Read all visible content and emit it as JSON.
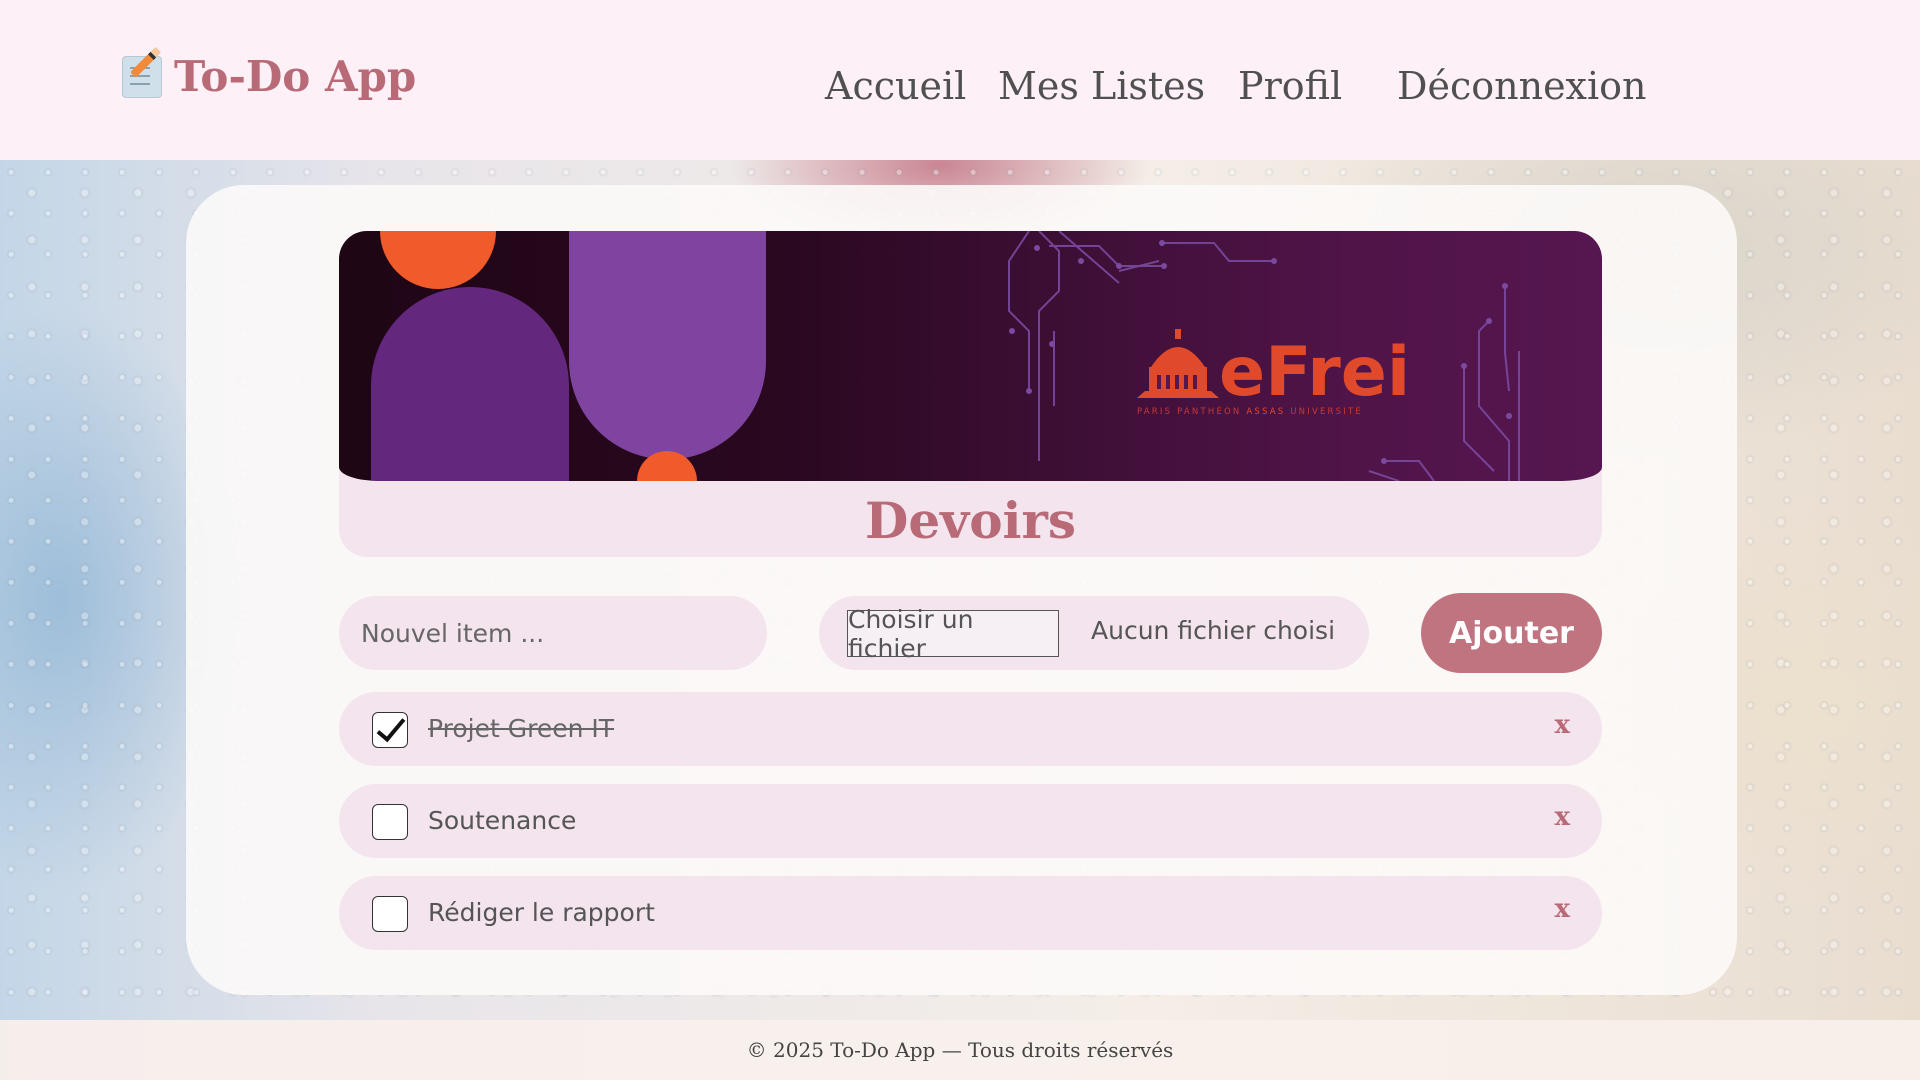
{
  "app": {
    "title": "To-Do App",
    "icon": "memo-pencil-icon"
  },
  "nav": {
    "items": [
      {
        "label": "Accueil"
      },
      {
        "label": "Mes Listes"
      },
      {
        "label": "Profil"
      },
      {
        "label": "Déconnexion"
      }
    ]
  },
  "banner": {
    "logo_text": "eFrei",
    "logo_subtitle_part1": "PARIS PANTHÉON",
    "logo_subtitle_part2": "ASSAS",
    "logo_subtitle_part3": "UNIVERSITÉ"
  },
  "list": {
    "title": "Devoirs"
  },
  "form": {
    "item_placeholder": "Nouvel item ...",
    "file_button_label": "Choisir un fichier",
    "file_status": "Aucun fichier choisi",
    "add_button_label": "Ajouter"
  },
  "tasks": [
    {
      "label": "Projet Green IT",
      "checked": true,
      "delete_label": "x"
    },
    {
      "label": "Soutenance",
      "checked": false,
      "delete_label": "x"
    },
    {
      "label": "Rédiger le rapport",
      "checked": false,
      "delete_label": "x"
    }
  ],
  "footer": {
    "text": "© 2025 To-Do App — Tous droits réservés"
  },
  "colors": {
    "accent": "#b86a77",
    "button": "#c07480",
    "header_bg": "#fdf0f7",
    "pill_bg": "#f3e4ee",
    "banner_purple": "#561650",
    "logo_orange": "#e04a2a"
  }
}
